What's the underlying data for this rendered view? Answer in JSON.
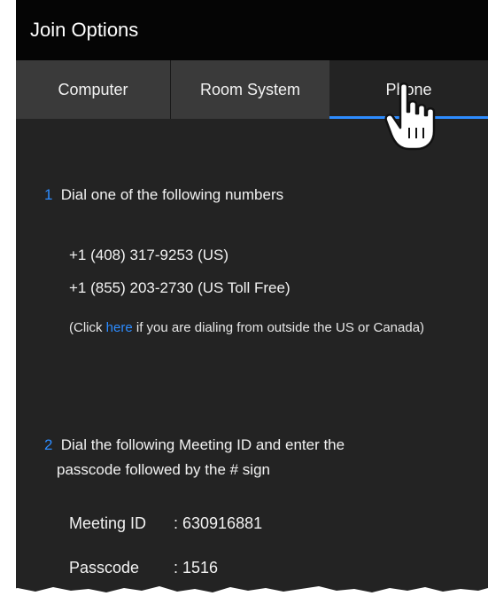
{
  "window": {
    "title": "Join Options"
  },
  "tabs": [
    {
      "label": "Computer"
    },
    {
      "label": "Room System"
    },
    {
      "label": "Phone",
      "selected": true
    }
  ],
  "step1": {
    "number": "1",
    "text": "Dial one of the following numbers",
    "numbers": [
      "+1 (408) 317-9253 (US)",
      "+1 (855) 203-2730 (US Toll Free)"
    ],
    "note_prefix": "(Click ",
    "note_link": "here",
    "note_suffix": " if you are dialing from outside the US or Canada)"
  },
  "step2": {
    "number": "2",
    "line1": "Dial the following Meeting ID and enter the",
    "line2": "passcode followed by the # sign",
    "meeting_id_label": "Meeting ID",
    "meeting_id_value": ": 630916881",
    "passcode_label": "Passcode",
    "passcode_value": ": 1516"
  },
  "colors": {
    "accent": "#2d8cff",
    "background": "#232323",
    "titlebar": "#050505"
  }
}
